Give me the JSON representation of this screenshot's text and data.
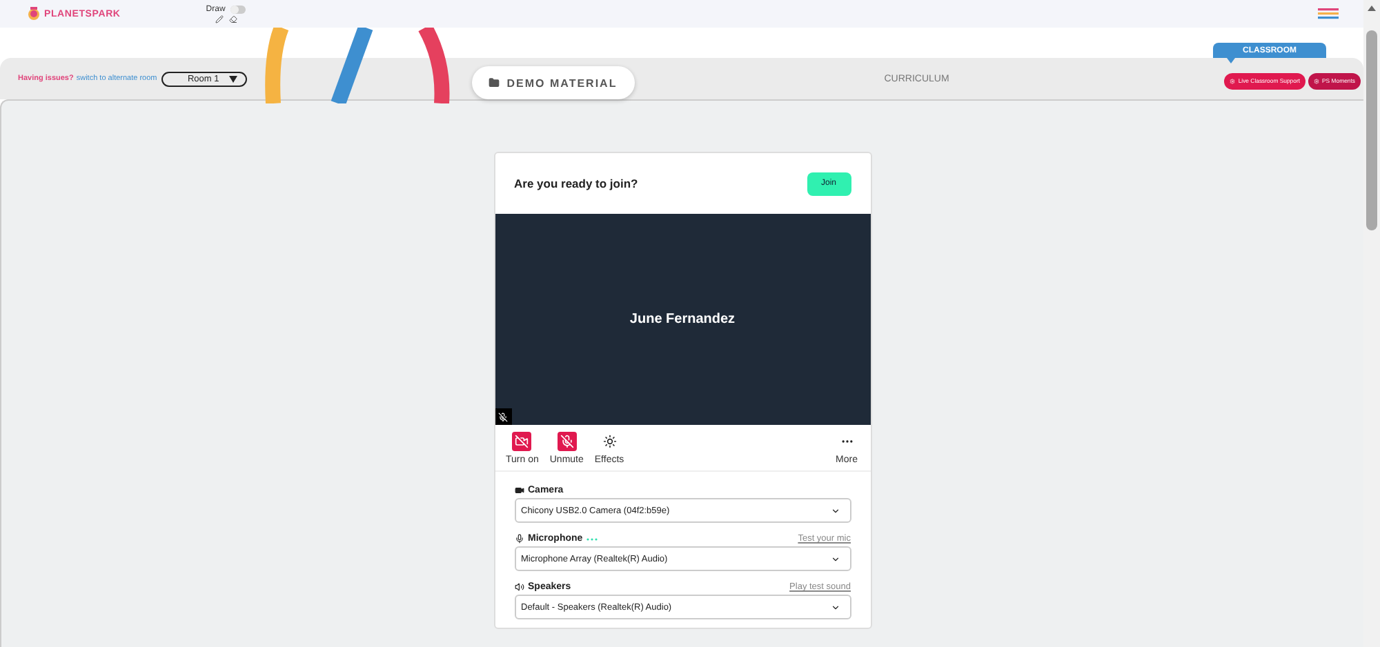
{
  "top_bar": {
    "logo": "PLANETSPARK",
    "draw_label": "Draw",
    "draw_on": false
  },
  "sub_bar": {
    "issue_text": "Having issues?",
    "switch_link": "switch to alternate room",
    "room": "Room 1",
    "demo_button": "DEMO MATERIAL",
    "curriculum": "CURRICULUM",
    "classroom_tab": "CLASSROOM",
    "support_buttons": [
      "Live Classroom Support",
      "PS Moments"
    ]
  },
  "join_card": {
    "title": "Are you ready to join?",
    "join_button": "Join",
    "participant": "June Fernandez",
    "controls": [
      {
        "kind": "camera",
        "label": "Turn on",
        "off": true
      },
      {
        "kind": "mic",
        "label": "Unmute",
        "off": true
      },
      {
        "kind": "effects",
        "label": "Effects",
        "off": false
      },
      {
        "kind": "more",
        "label": "More",
        "off": false
      }
    ],
    "devices": [
      {
        "kind": "camera",
        "label": "Camera",
        "value": "Chicony USB2.0 Camera (04f2:b59e)"
      },
      {
        "kind": "microphone",
        "label": "Microphone",
        "link": "Test your mic",
        "value": "Microphone Array (Realtek(R) Audio)"
      },
      {
        "kind": "speakers",
        "label": "Speakers",
        "link": "Play test sound",
        "value": "Default - Speakers (Realtek(R) Audio)"
      }
    ]
  }
}
